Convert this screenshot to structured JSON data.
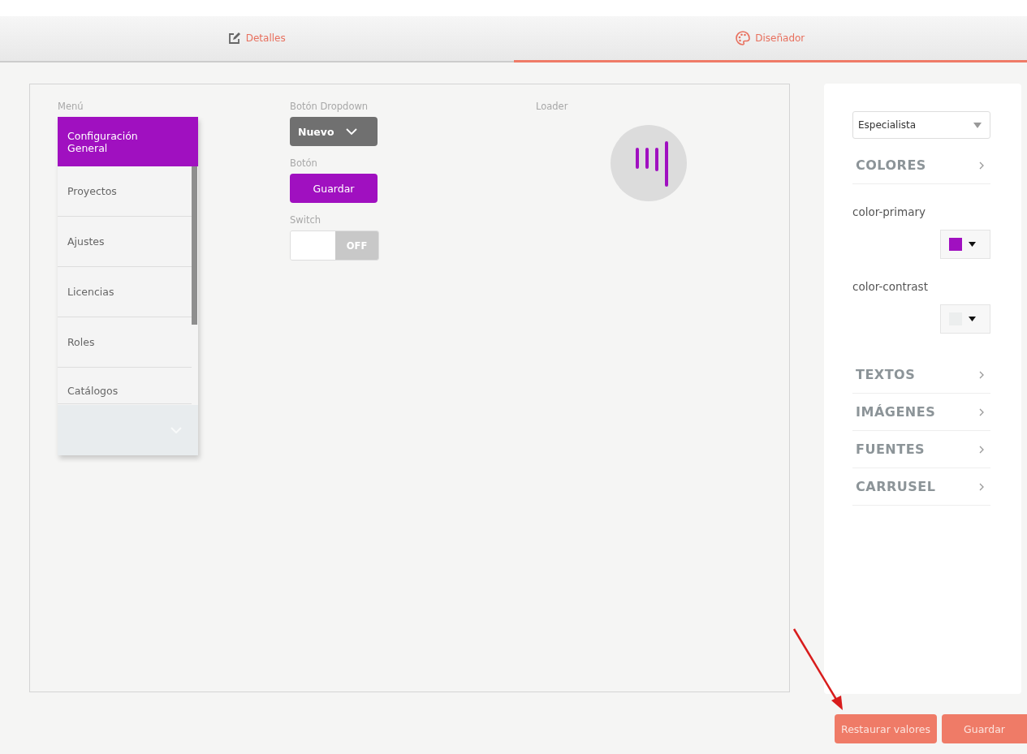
{
  "tabs": [
    {
      "label": "Detalles",
      "kind": "edit",
      "selected": false
    },
    {
      "label": "Diseñador",
      "kind": "palette",
      "selected": true
    }
  ],
  "preview": {
    "menu": {
      "label": "Menú",
      "items": [
        {
          "label": "Configuración General",
          "selected": true
        },
        {
          "label": "Proyectos",
          "selected": false
        },
        {
          "label": "Ajustes",
          "selected": false
        },
        {
          "label": "Licencias",
          "selected": false
        },
        {
          "label": "Roles",
          "selected": false
        },
        {
          "label": "Catálogos",
          "selected": false
        }
      ]
    },
    "dropdown_button": {
      "label": "Botón Dropdown",
      "value": "Nuevo"
    },
    "button": {
      "label": "Botón",
      "text": "Guardar"
    },
    "switch": {
      "label": "Switch",
      "on": false,
      "state_text": "OFF"
    },
    "loader": {
      "label": "Loader"
    }
  },
  "panel": {
    "select": "Especialista",
    "sections": [
      {
        "kind": "section",
        "title": "COLORES"
      },
      {
        "kind": "color",
        "label": "color-primary",
        "color": "#a010c0"
      },
      {
        "kind": "color",
        "label": "color-contrast",
        "color": "#eceeee"
      },
      {
        "kind": "section",
        "title": "TEXTOS"
      },
      {
        "kind": "section",
        "title": "IMÁGENES"
      },
      {
        "kind": "section",
        "title": "FUENTES"
      },
      {
        "kind": "section",
        "title": "CARRUSEL"
      }
    ]
  },
  "footer_buttons": [
    "Restaurar valores",
    "Guardar"
  ]
}
